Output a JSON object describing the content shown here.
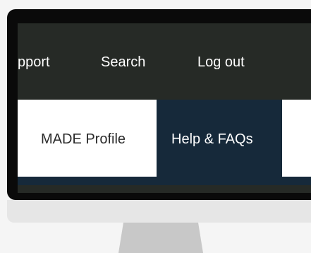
{
  "top_nav": {
    "items": [
      {
        "label": "pport"
      },
      {
        "label": "Search"
      },
      {
        "label": "Log out"
      }
    ]
  },
  "sub_nav": {
    "tabs": [
      {
        "label": "MADE Profile"
      },
      {
        "label": "Help & FAQs"
      }
    ]
  },
  "colors": {
    "top_nav_bg": "#262a26",
    "active_tab_bg": "#16293a",
    "inactive_tab_bg": "#ffffff",
    "monitor_bezel": "#0a0a0a",
    "monitor_chin": "#e6e6e6",
    "stand": "#c8c8c8"
  }
}
